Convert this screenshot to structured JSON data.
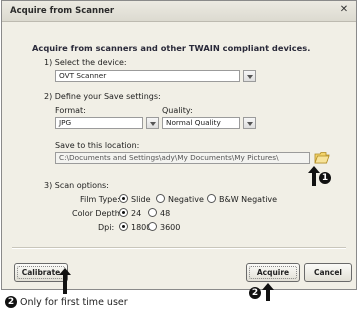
{
  "window": {
    "title": "Acquire from Scanner",
    "close_glyph": "✕"
  },
  "heading": "Acquire from scanners and other TWAIN compliant devices.",
  "device": {
    "label": "1) Select the device:",
    "value": "OVT Scanner"
  },
  "save_settings": {
    "label": "2) Define your Save settings:",
    "format_label": "Format:",
    "format_value": "JPG",
    "quality_label": "Quality:",
    "quality_value": "Normal Quality"
  },
  "location": {
    "label": "Save to this location:",
    "value": "C:\\Documents and Settings\\ady\\My Documents\\My Pictures\\",
    "folder_icon": "folder-icon"
  },
  "scan_options": {
    "label": "3) Scan options:",
    "film_type_label": "Film Type:",
    "film_types": [
      {
        "label": "Slide",
        "selected": true
      },
      {
        "label": "Negative",
        "selected": false
      },
      {
        "label": "B&W Negative",
        "selected": false
      }
    ],
    "color_depth_label": "Color Depth:",
    "color_depths": [
      {
        "label": "24",
        "selected": true
      },
      {
        "label": "48",
        "selected": false
      }
    ],
    "dpi_label": "Dpi:",
    "dpis": [
      {
        "label": "1800",
        "selected": true
      },
      {
        "label": "3600",
        "selected": false
      }
    ]
  },
  "buttons": {
    "calibrate": "Calibrate",
    "acquire": "Acquire",
    "cancel": "Cancel"
  },
  "annotations": {
    "callout_1": "1",
    "callout_2_top": "2",
    "callout_2_bottom": "2",
    "note": "Only for first time user"
  }
}
